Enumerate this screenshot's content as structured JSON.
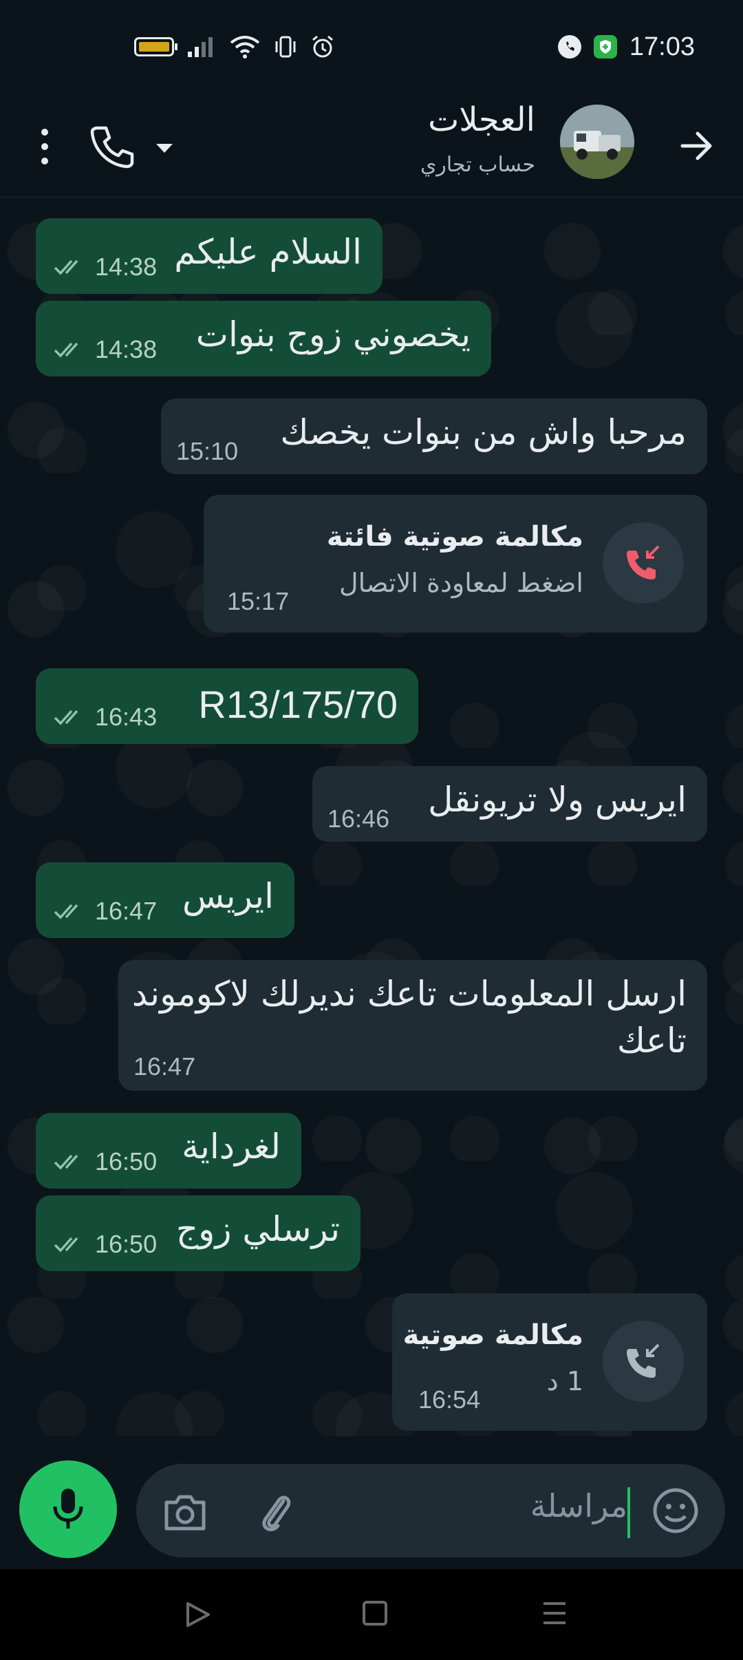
{
  "status_bar": {
    "time": "17:03",
    "icons": [
      "battery-icon",
      "signal-icon",
      "wifi-icon",
      "vibrate-icon",
      "alarm-icon",
      "app-notification-icon",
      "shield-icon"
    ],
    "battery_color": "#d4a418"
  },
  "header": {
    "contact_name": "العجلات",
    "contact_subtitle": "حساب تجاري",
    "icons": [
      "back-arrow-icon",
      "avatar",
      "phone-icon",
      "dropdown-arrow-icon",
      "more-vert-icon"
    ]
  },
  "messages": [
    {
      "direction": "out",
      "text": "السلام عليكم",
      "time": "14:38",
      "read": true
    },
    {
      "direction": "out",
      "text": "يخصوني زوج بنوات",
      "time": "14:38",
      "read": true
    },
    {
      "direction": "in",
      "text": "مرحبا واش من بنوات يخصك",
      "time": "15:10"
    },
    {
      "direction": "in",
      "type": "missed-call",
      "title": "مكالمة صوتية فائتة",
      "subtitle": "اضغط لمعاودة الاتصال",
      "time": "15:17"
    },
    {
      "direction": "out",
      "text": "175/70/R13",
      "time": "16:43",
      "read": true
    },
    {
      "direction": "in",
      "text": "ايريس ولا تريونقل",
      "time": "16:46"
    },
    {
      "direction": "out",
      "text": "ايريس",
      "time": "16:47",
      "read": true
    },
    {
      "direction": "in",
      "text_line1": "ارسل المعلومات تاعك نديرلك لاكوموند",
      "text_line2": "تاعك",
      "time": "16:47"
    },
    {
      "direction": "out",
      "text": "لغرداية",
      "time": "16:50",
      "read": true
    },
    {
      "direction": "out",
      "text": "ترسلي زوج",
      "time": "16:50",
      "read": true
    },
    {
      "direction": "in",
      "type": "voice-call",
      "title": "مكالمة صوتية",
      "subtitle": "1 د",
      "time": "16:54"
    }
  ],
  "composer": {
    "placeholder": "مراسلة",
    "icons": [
      "mic-icon",
      "camera-icon",
      "attach-icon",
      "sticker-icon"
    ]
  },
  "colors": {
    "background": "#0b141a",
    "outgoing_bubble": "#144d37",
    "incoming_bubble": "#1f2c34",
    "accent": "#21c063",
    "missed_call": "#f15c6d"
  }
}
